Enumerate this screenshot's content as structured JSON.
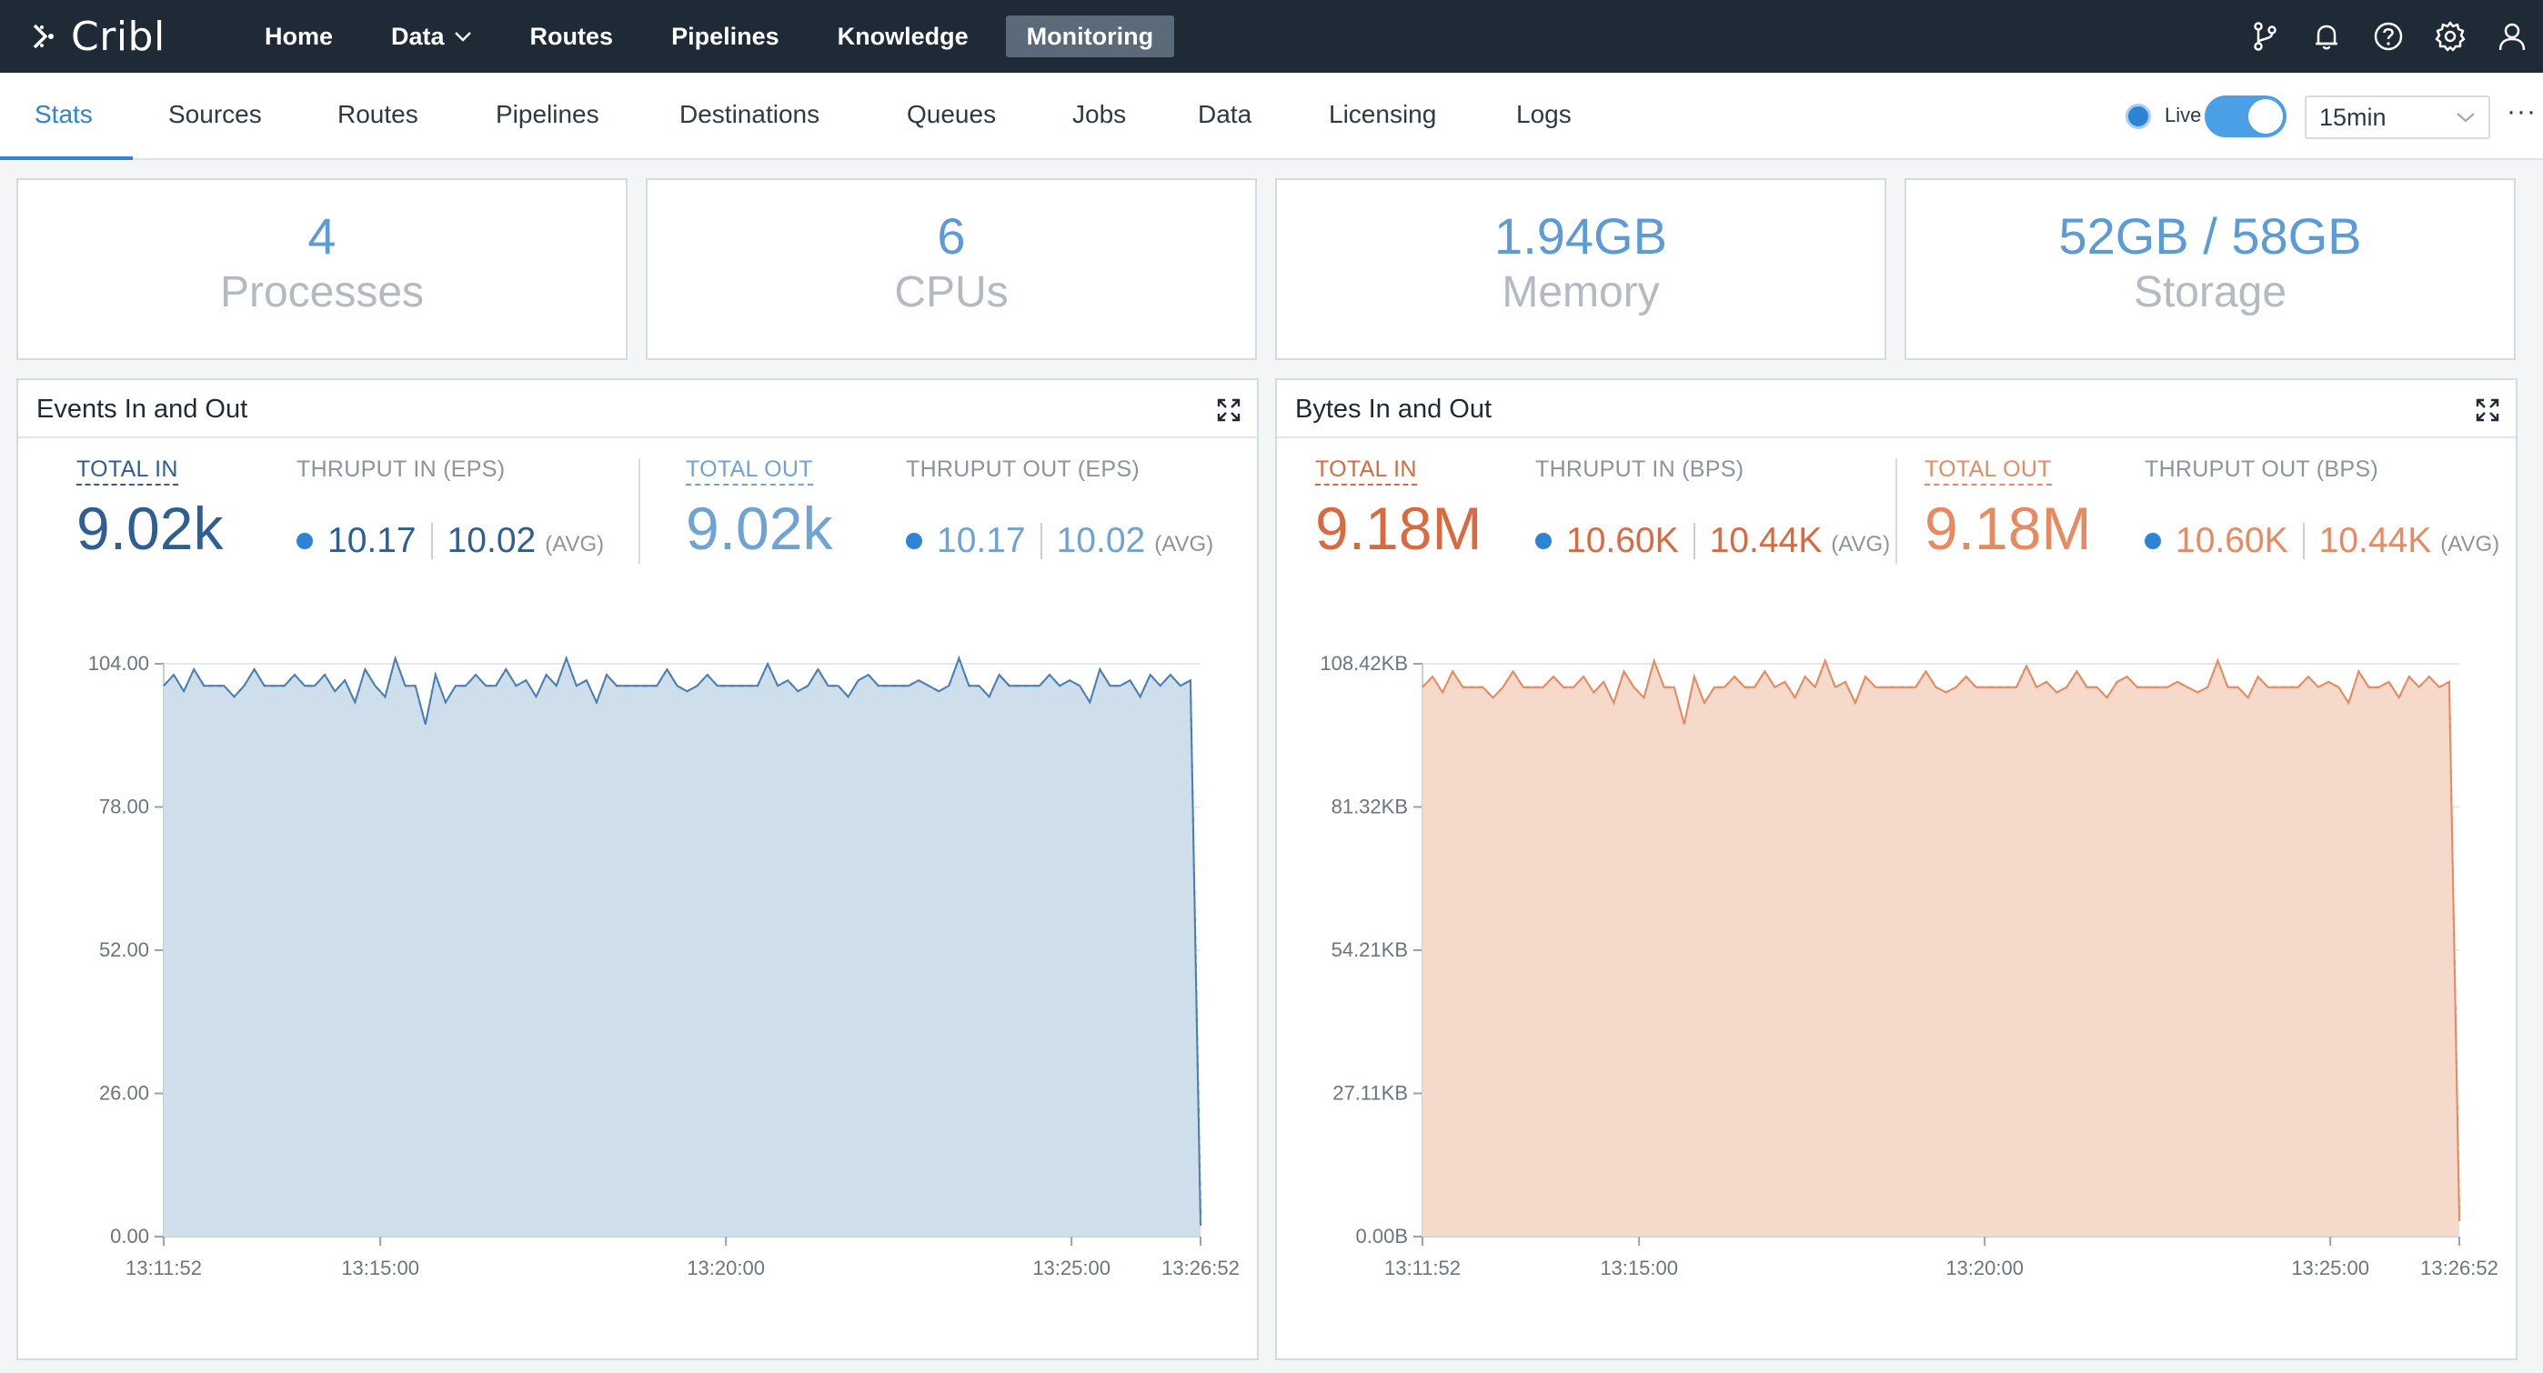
{
  "app": {
    "logo_text": "Cribl",
    "nav": [
      {
        "label": "Home"
      },
      {
        "label": "Data"
      },
      {
        "label": "Routes"
      },
      {
        "label": "Pipelines"
      },
      {
        "label": "Knowledge"
      },
      {
        "label": "Monitoring"
      }
    ],
    "nav_icons": [
      "git-branch-icon",
      "bell-icon",
      "help-icon",
      "gear-icon",
      "user-icon"
    ]
  },
  "subnav": {
    "tabs": [
      "Stats",
      "Sources",
      "Routes",
      "Pipelines",
      "Destinations",
      "Queues",
      "Jobs",
      "Data",
      "Licensing",
      "Logs"
    ],
    "active_tab": "Stats",
    "live_label": "Live",
    "live_enabled": true,
    "time_range": "15min",
    "more": "···"
  },
  "stats": [
    {
      "value": "4",
      "label": "Processes"
    },
    {
      "value": "6",
      "label": "CPUs"
    },
    {
      "value": "1.94GB",
      "label": "Memory"
    },
    {
      "value": "52GB / 58GB",
      "label": "Storage"
    }
  ],
  "colors": {
    "events_accent": "#2e5f94",
    "events_out": "#6ea3d4",
    "events_fill": "#cfdeeb",
    "events_line": "#4a7fb6",
    "bytes_accent": "#d96a3f",
    "bytes_out": "#e88a60",
    "bytes_fill": "#f5d9cb",
    "bytes_line": "#e8895f",
    "blue_dot": "#2d84d4"
  },
  "events_panel": {
    "title": "Events In and Out",
    "total_in_label": "TOTAL IN",
    "total_in": "9.02k",
    "thruput_in_label": "THRUPUT IN (EPS)",
    "thruput_in_current": "10.17",
    "thruput_in_avg": "10.02",
    "avg_label": "(AVG)",
    "total_out_label": "TOTAL OUT",
    "total_out": "9.02k",
    "thruput_out_label": "THRUPUT OUT (EPS)",
    "thruput_out_current": "10.17",
    "thruput_out_avg": "10.02"
  },
  "bytes_panel": {
    "title": "Bytes In and Out",
    "total_in_label": "TOTAL IN",
    "total_in": "9.18M",
    "thruput_in_label": "THRUPUT IN (BPS)",
    "thruput_in_current": "10.60K",
    "thruput_in_avg": "10.44K",
    "avg_label": "(AVG)",
    "total_out_label": "TOTAL OUT",
    "total_out": "9.18M",
    "thruput_out_label": "THRUPUT OUT (BPS)",
    "thruput_out_current": "10.60K",
    "thruput_out_avg": "10.44K"
  },
  "chart_data": [
    {
      "type": "area",
      "title": "Events In and Out",
      "ylim": [
        0,
        104
      ],
      "yticks": [
        "0.00",
        "26.00",
        "52.00",
        "78.00",
        "104.00"
      ],
      "xticks": [
        "13:11:52",
        "13:15:00",
        "13:20:00",
        "13:25:00",
        "13:26:52"
      ],
      "x_range": [
        "13:11:52",
        "13:26:52"
      ],
      "grid": true,
      "series": [
        {
          "values": [
            100,
            102,
            99,
            103,
            100,
            100,
            100,
            98,
            100,
            103,
            100,
            100,
            100,
            102,
            100,
            100,
            102,
            99,
            101,
            97,
            103,
            100,
            98,
            105,
            100,
            100,
            93,
            102,
            97,
            100,
            100,
            102,
            100,
            100,
            103,
            100,
            101,
            98,
            102,
            100,
            105,
            100,
            101,
            97,
            102,
            100,
            100,
            100,
            100,
            100,
            103,
            100,
            99,
            100,
            102,
            100,
            100,
            100,
            100,
            100,
            104,
            100,
            101,
            99,
            100,
            103,
            100,
            100,
            98,
            101,
            102,
            100,
            100,
            100,
            100,
            101,
            100,
            99,
            100,
            105,
            100,
            100,
            98,
            102,
            100,
            100,
            100,
            100,
            102,
            100,
            101,
            100,
            97,
            103,
            100,
            100,
            101,
            98,
            102,
            100,
            102,
            100,
            101,
            2
          ]
        },
        {
          "values": [
            100,
            102,
            99,
            103,
            100,
            100,
            100,
            98,
            100,
            103,
            100,
            100,
            100,
            102,
            100,
            100,
            102,
            99,
            101,
            97,
            103,
            100,
            98,
            105,
            100,
            100,
            93,
            102,
            97,
            100,
            100,
            102,
            100,
            100,
            103,
            100,
            101,
            98,
            102,
            100,
            105,
            100,
            101,
            97,
            102,
            100,
            100,
            100,
            100,
            100,
            103,
            100,
            99,
            100,
            102,
            100,
            100,
            100,
            100,
            100,
            104,
            100,
            101,
            99,
            100,
            103,
            100,
            100,
            98,
            101,
            102,
            100,
            100,
            100,
            100,
            101,
            100,
            99,
            100,
            105,
            100,
            100,
            98,
            102,
            100,
            100,
            100,
            100,
            102,
            100,
            101,
            100,
            97,
            103,
            100,
            100,
            101,
            98,
            102,
            100,
            102,
            100,
            101,
            4
          ]
        }
      ]
    },
    {
      "type": "area",
      "title": "Bytes In and Out",
      "ylim": [
        0,
        108.42
      ],
      "yticks": [
        "0.00B",
        "27.11KB",
        "54.21KB",
        "81.32KB",
        "108.42KB"
      ],
      "xticks": [
        "13:11:52",
        "13:15:00",
        "13:20:00",
        "13:25:00",
        "13:26:52"
      ],
      "x_range": [
        "13:11:52",
        "13:26:52"
      ],
      "grid": true,
      "series": [
        {
          "values": [
            104,
            106,
            103,
            107,
            104,
            104,
            104,
            102,
            104,
            107,
            104,
            104,
            104,
            106,
            104,
            104,
            106,
            103,
            105,
            101,
            107,
            104,
            102,
            109,
            104,
            104,
            97,
            106,
            101,
            104,
            104,
            106,
            104,
            104,
            107,
            104,
            105,
            102,
            106,
            104,
            109,
            104,
            105,
            101,
            106,
            104,
            104,
            104,
            104,
            104,
            107,
            104,
            103,
            104,
            106,
            104,
            104,
            104,
            104,
            104,
            108,
            104,
            105,
            103,
            104,
            107,
            104,
            104,
            102,
            105,
            106,
            104,
            104,
            104,
            104,
            105,
            104,
            103,
            104,
            109,
            104,
            104,
            102,
            106,
            104,
            104,
            104,
            104,
            106,
            104,
            105,
            104,
            101,
            107,
            104,
            104,
            105,
            102,
            106,
            104,
            106,
            104,
            105,
            3
          ]
        },
        {
          "values": [
            104,
            106,
            103,
            107,
            104,
            104,
            104,
            102,
            104,
            107,
            104,
            104,
            104,
            106,
            104,
            104,
            106,
            103,
            105,
            101,
            107,
            104,
            102,
            109,
            104,
            104,
            97,
            106,
            101,
            104,
            104,
            106,
            104,
            104,
            107,
            104,
            105,
            102,
            106,
            104,
            109,
            104,
            105,
            101,
            106,
            104,
            104,
            104,
            104,
            104,
            107,
            104,
            103,
            104,
            106,
            104,
            104,
            104,
            104,
            104,
            108,
            104,
            105,
            103,
            104,
            107,
            104,
            104,
            102,
            105,
            106,
            104,
            104,
            104,
            104,
            105,
            104,
            103,
            104,
            109,
            104,
            104,
            102,
            106,
            104,
            104,
            104,
            104,
            106,
            104,
            105,
            104,
            101,
            107,
            104,
            104,
            105,
            102,
            106,
            104,
            106,
            104,
            105,
            5
          ]
        }
      ]
    }
  ]
}
